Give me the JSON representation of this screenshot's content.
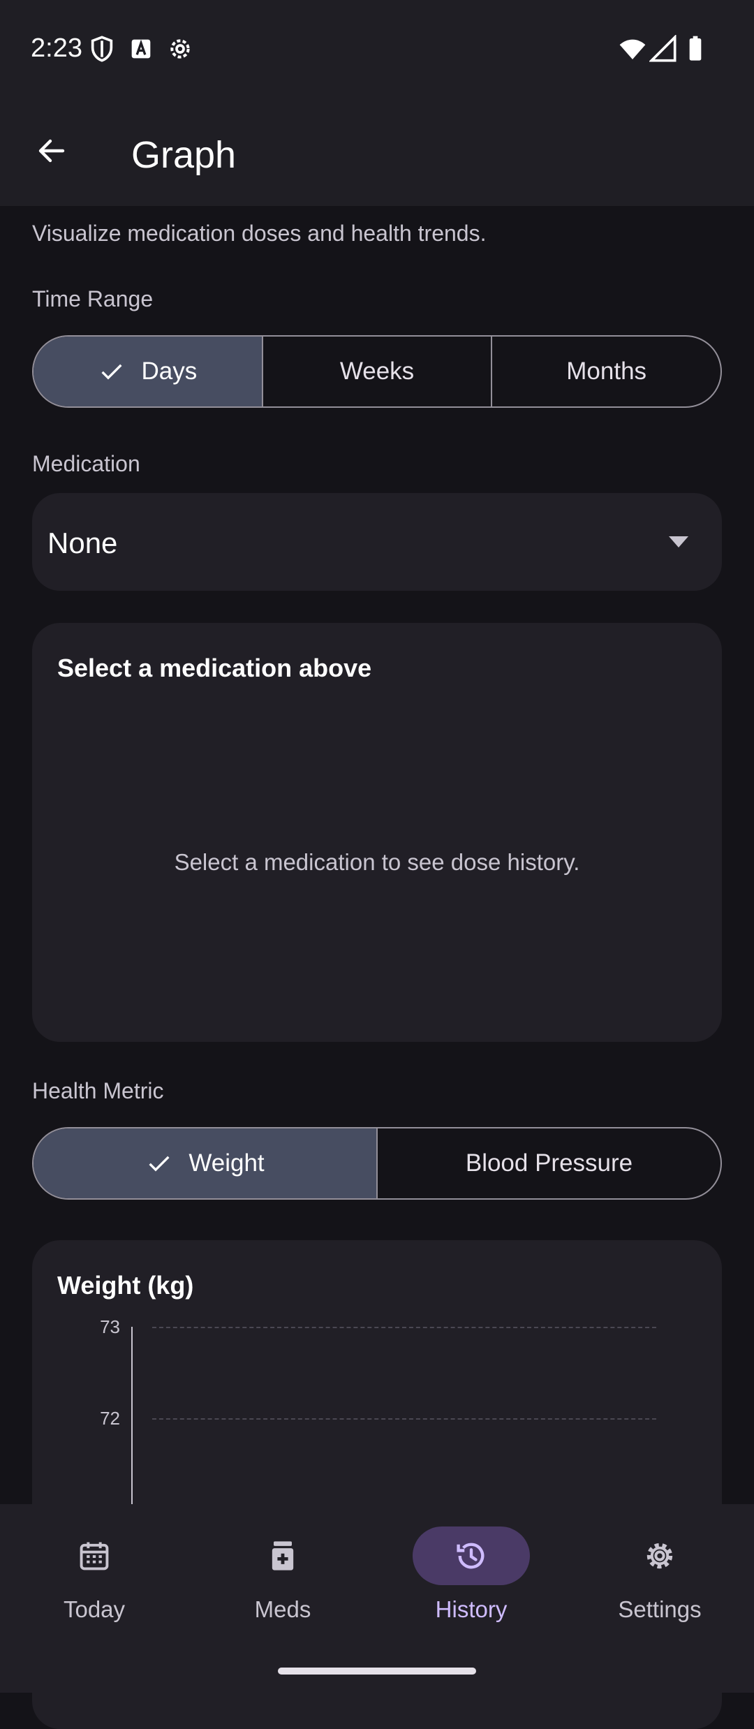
{
  "status_bar": {
    "time": "2:23"
  },
  "app_bar": {
    "title": "Graph"
  },
  "subtitle": "Visualize medication doses and health trends.",
  "time_range": {
    "label": "Time Range",
    "options": [
      "Days",
      "Weeks",
      "Months"
    ],
    "selected": "Days"
  },
  "medication": {
    "label": "Medication",
    "value": "None"
  },
  "dose_card": {
    "title": "Select a medication above",
    "empty_text": "Select a medication to see dose history."
  },
  "health_metric": {
    "label": "Health Metric",
    "options": [
      "Weight",
      "Blood Pressure"
    ],
    "selected": "Weight"
  },
  "weight_card": {
    "title": "Weight (kg)"
  },
  "chart_data": {
    "type": "line",
    "title": "Weight (kg)",
    "ylabel": "",
    "xlabel": "",
    "y_ticks": [
      "73",
      "72"
    ],
    "grid": true,
    "series": []
  },
  "bottom_nav": {
    "items": [
      {
        "label": "Today",
        "icon": "calendar-icon"
      },
      {
        "label": "Meds",
        "icon": "medication-icon"
      },
      {
        "label": "History",
        "icon": "history-icon"
      },
      {
        "label": "Settings",
        "icon": "gear-icon"
      }
    ],
    "active": "History"
  },
  "colors": {
    "background": "#141318",
    "surface": "#211f26",
    "selected_segment": "#474d61",
    "nav_active_pill": "#4a3a66",
    "nav_active_text": "#cfbcff"
  }
}
